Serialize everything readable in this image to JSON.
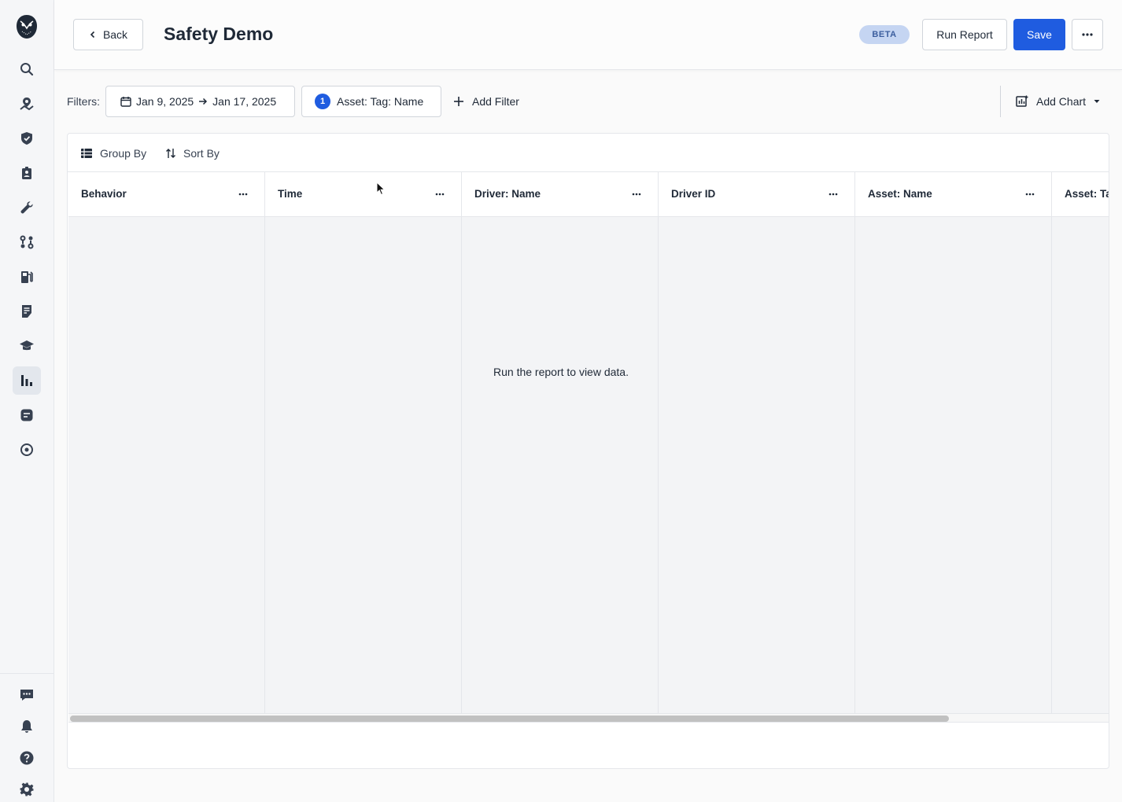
{
  "header": {
    "back_label": "Back",
    "title": "Safety Demo",
    "badge": "BETA",
    "run_label": "Run Report",
    "save_label": "Save"
  },
  "filters": {
    "label": "Filters:",
    "date_start": "Jan 9, 2025",
    "date_end": "Jan 17, 2025",
    "tag_count": "1",
    "tag_label": "Asset: Tag: Name",
    "add_filter_label": "Add Filter",
    "add_chart_label": "Add Chart"
  },
  "toolbar": {
    "group_by_label": "Group By",
    "sort_by_label": "Sort By"
  },
  "table": {
    "columns": [
      "Behavior",
      "Time",
      "Driver: Name",
      "Driver ID",
      "Asset: Name",
      "Asset: Tag: Name"
    ],
    "empty_message": "Run the report to view data."
  },
  "sidebar": {
    "items": [
      "search-icon",
      "map-pin-icon",
      "shield-icon",
      "id-badge-icon",
      "wrench-icon",
      "route-icon",
      "fuel-icon",
      "document-icon",
      "graduation-icon",
      "reports-icon",
      "message-icon",
      "target-icon"
    ],
    "bottom_items": [
      "chat-icon",
      "bell-icon",
      "help-icon",
      "gear-icon"
    ],
    "active": "reports-icon"
  },
  "colors": {
    "primary": "#1f5ce0",
    "badge_bg": "#c5d5f2",
    "badge_text": "#3c5e9e"
  }
}
